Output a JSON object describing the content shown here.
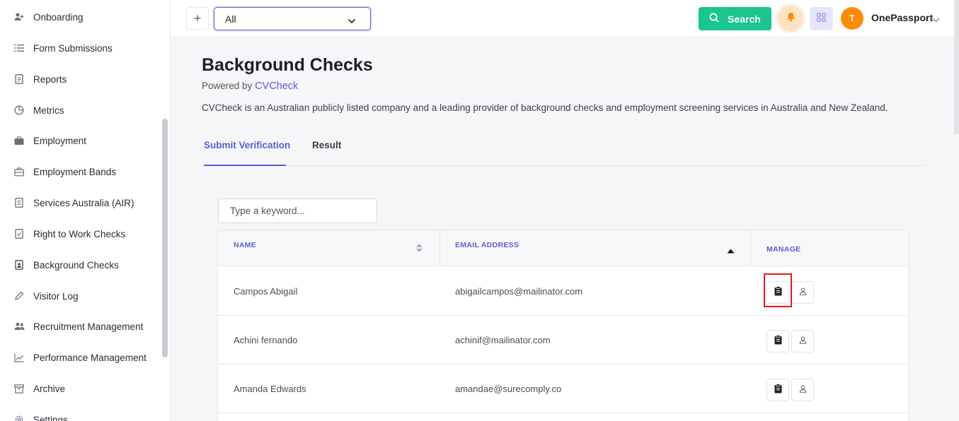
{
  "sidebar": {
    "items": [
      {
        "label": "Onboarding",
        "icon": "add-user-icon"
      },
      {
        "label": "Form Submissions",
        "icon": "list-icon"
      },
      {
        "label": "Reports",
        "icon": "document-icon"
      },
      {
        "label": "Metrics",
        "icon": "pie-chart-icon"
      },
      {
        "label": "Employment",
        "icon": "briefcase-icon"
      },
      {
        "label": "Employment Bands",
        "icon": "briefcase-outline-icon"
      },
      {
        "label": "Services Australia (AIR)",
        "icon": "file-text-icon"
      },
      {
        "label": "Right to Work Checks",
        "icon": "file-check-icon"
      },
      {
        "label": "Background Checks",
        "icon": "file-user-icon"
      },
      {
        "label": "Visitor Log",
        "icon": "pen-icon"
      },
      {
        "label": "Recruitment Management",
        "icon": "users-icon"
      },
      {
        "label": "Performance Management",
        "icon": "trend-icon"
      },
      {
        "label": "Archive",
        "icon": "archive-icon"
      },
      {
        "label": "Settings",
        "icon": "gear-icon"
      }
    ]
  },
  "topbar": {
    "plus": "+",
    "select_value": "All",
    "search_label": "Search",
    "avatar_initial": "T",
    "user_name": "OnePassport"
  },
  "page": {
    "title": "Background Checks",
    "powered_prefix": "Powered by",
    "powered_link": "CVCheck",
    "description": "CVCheck is an Australian publicly listed company and a leading provider of background checks and employment screening services in Australia and New Zealand.",
    "tabs": [
      {
        "label": "Submit Verification",
        "active": true
      },
      {
        "label": "Result",
        "active": false
      }
    ]
  },
  "search": {
    "placeholder": "Type a keyword..."
  },
  "table": {
    "headers": {
      "name": "NAME",
      "email": "EMAIL ADDRESS",
      "manage": "MANAGE"
    },
    "rows": [
      {
        "name": "Campos Abigail",
        "email": "abigailcampos@mailinator.com"
      },
      {
        "name": "Achini fernando",
        "email": "achinif@mailinator.com"
      },
      {
        "name": "Amanda Edwards",
        "email": "amandae@surecomply.co"
      }
    ]
  },
  "colors": {
    "accent": "#5a5fd6",
    "search_green": "#1bc58f",
    "avatar_orange": "#ff8a00",
    "highlight_red": "#e11b1b"
  }
}
